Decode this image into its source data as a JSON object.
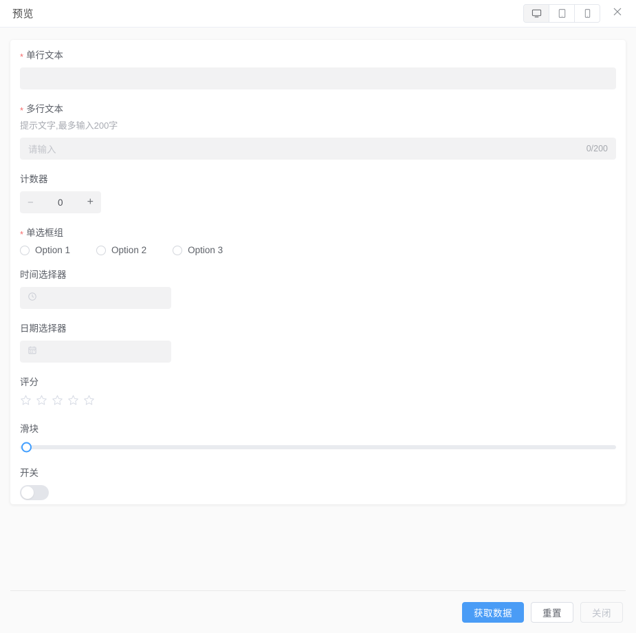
{
  "header": {
    "title": "预览",
    "devices": [
      {
        "name": "desktop",
        "icon": "monitor-icon",
        "active": true
      },
      {
        "name": "tablet",
        "icon": "tablet-icon",
        "active": false
      },
      {
        "name": "mobile",
        "icon": "mobile-icon",
        "active": false
      }
    ],
    "close_icon": "close-icon"
  },
  "form": {
    "single_text": {
      "label": "单行文本",
      "required": true,
      "value": "",
      "placeholder": ""
    },
    "multi_text": {
      "label": "多行文本",
      "required": true,
      "hint": "提示文字,最多输入200字",
      "placeholder": "请输入",
      "value": "",
      "counter": "0/200"
    },
    "counter": {
      "label": "计数器",
      "required": false,
      "value": "0",
      "minus_label": "−",
      "plus_label": "+"
    },
    "radio_group": {
      "label": "单选框组",
      "required": true,
      "options": [
        {
          "label": "Option 1",
          "checked": false
        },
        {
          "label": "Option 2",
          "checked": false
        },
        {
          "label": "Option 3",
          "checked": false
        }
      ]
    },
    "time_picker": {
      "label": "时间选择器",
      "required": false,
      "value": "",
      "icon": "clock-icon"
    },
    "date_picker": {
      "label": "日期选择器",
      "required": false,
      "value": "",
      "icon": "calendar-icon"
    },
    "rating": {
      "label": "评分",
      "required": false,
      "value": 0,
      "max": 5
    },
    "slider": {
      "label": "滑块",
      "required": false,
      "value": 0,
      "min": 0,
      "max": 100
    },
    "switch": {
      "label": "开关",
      "required": false,
      "value": false
    }
  },
  "footer": {
    "get_data_label": "获取数据",
    "reset_label": "重置",
    "close_label": "关闭"
  },
  "colors": {
    "primary": "#4a9cf6",
    "slider_accent": "#409eff",
    "required_star": "#f56c6c",
    "field_bg": "#f2f2f3",
    "page_bg": "#fafafa"
  }
}
